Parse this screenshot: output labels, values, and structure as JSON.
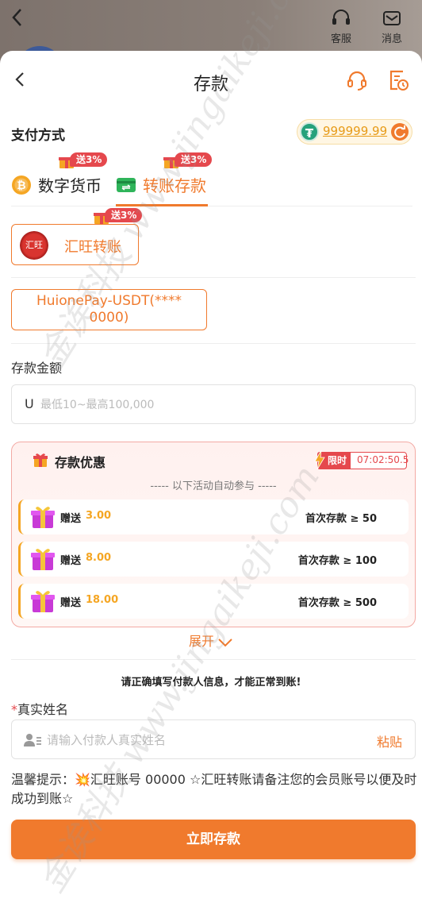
{
  "background": {
    "service_label": "客服",
    "message_label": "消息"
  },
  "header": {
    "title": "存款"
  },
  "payment": {
    "section_title": "支付方式",
    "balance": "999999.99"
  },
  "tabs": [
    {
      "label": "数字货币",
      "badge": "送3%",
      "active": false
    },
    {
      "label": "转账存款",
      "badge": "送3%",
      "active": true
    }
  ],
  "method": {
    "label": "汇旺转账",
    "logo_text": "汇旺",
    "badge": "送3%"
  },
  "channel": {
    "label": "HuionePay-USDT(**** 0000)"
  },
  "amount": {
    "label": "存款金额",
    "currency": "U",
    "placeholder": "最低10~最高100,000"
  },
  "promo": {
    "title": "存款优惠",
    "limit_tag": "限时",
    "countdown": "07:02:50.5",
    "subtitle": "----- 以下活动自动参与 -----",
    "items": [
      {
        "give": "赠送",
        "value": "3.00",
        "condition": "首次存款 ≥ 50"
      },
      {
        "give": "赠送",
        "value": "8.00",
        "condition": "首次存款 ≥ 100"
      },
      {
        "give": "赠送",
        "value": "18.00",
        "condition": "首次存款 ≥ 500"
      }
    ],
    "expand_label": "展开"
  },
  "notice": "请正确填写付款人信息，才能正常到账!",
  "name": {
    "required_mark": "*",
    "label": "真实姓名",
    "placeholder": "请输入付款人真实姓名",
    "paste_label": "粘贴"
  },
  "tip": "温馨提示：💥汇旺账号 00000 ☆汇旺转账请备注您的会员账号以便及时成功到账☆",
  "submit_label": "立即存款",
  "watermark": "金诶科技 www.jingaikeji.com",
  "colors": {
    "accent": "#f07a2d",
    "badge_red": "#e5484d",
    "promo_gold": "#f5a623",
    "usdt_green": "#26a17b"
  }
}
